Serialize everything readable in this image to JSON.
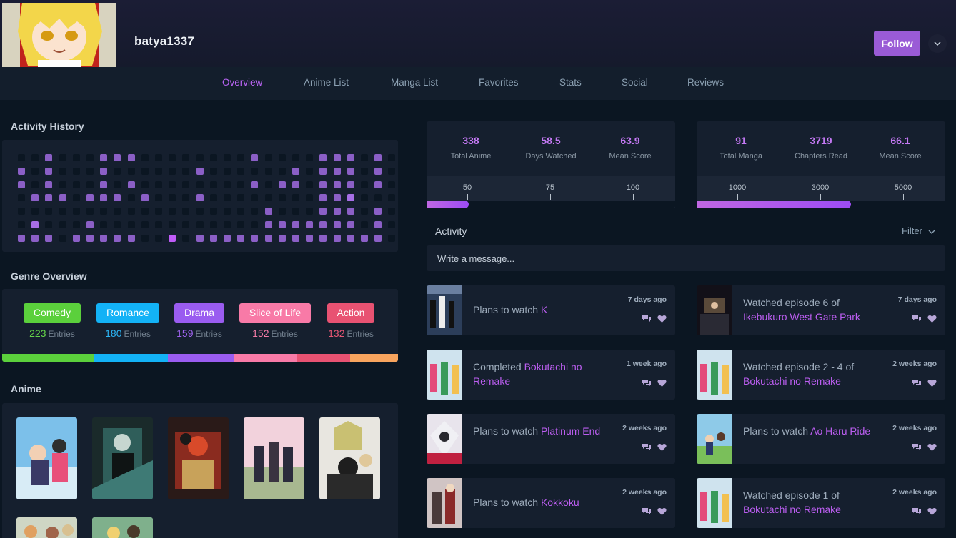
{
  "profile": {
    "username": "batya1337",
    "follow_label": "Follow"
  },
  "icons": {
    "dropdown": "chevron-down-icon",
    "filter": "chevron-down-icon",
    "reply": "comments-icon",
    "like": "heart-icon"
  },
  "nav": [
    "Overview",
    "Anime List",
    "Manga List",
    "Favorites",
    "Stats",
    "Social",
    "Reviews"
  ],
  "nav_active": "Overview",
  "sections": {
    "activity_history": "Activity History",
    "genre_overview": "Genre Overview",
    "anime": "Anime",
    "activity": "Activity"
  },
  "activity_grid": {
    "rows": [
      [
        0,
        0,
        1,
        0,
        0,
        0,
        1,
        1,
        1,
        0,
        0,
        0,
        0,
        0,
        0,
        0,
        0,
        1,
        0,
        0,
        0,
        0,
        1,
        1,
        1,
        0,
        1,
        0
      ],
      [
        1,
        0,
        1,
        0,
        0,
        0,
        1,
        0,
        0,
        0,
        0,
        0,
        0,
        1,
        0,
        0,
        0,
        0,
        0,
        0,
        1,
        0,
        1,
        1,
        1,
        0,
        1,
        0
      ],
      [
        1,
        0,
        1,
        0,
        0,
        0,
        1,
        0,
        1,
        0,
        0,
        0,
        0,
        0,
        0,
        0,
        0,
        1,
        0,
        1,
        1,
        0,
        1,
        1,
        1,
        0,
        1,
        0
      ],
      [
        0,
        1,
        1,
        1,
        0,
        1,
        1,
        1,
        0,
        1,
        0,
        0,
        0,
        1,
        0,
        0,
        0,
        0,
        0,
        0,
        0,
        0,
        1,
        1,
        2,
        0,
        0,
        0
      ],
      [
        0,
        0,
        0,
        0,
        0,
        0,
        0,
        0,
        0,
        0,
        0,
        0,
        0,
        0,
        0,
        0,
        0,
        0,
        1,
        0,
        0,
        0,
        1,
        1,
        1,
        0,
        1,
        0
      ],
      [
        0,
        2,
        0,
        0,
        0,
        1,
        0,
        0,
        0,
        0,
        0,
        0,
        0,
        0,
        0,
        0,
        0,
        0,
        1,
        1,
        1,
        1,
        1,
        1,
        1,
        0,
        1,
        0
      ],
      [
        1,
        1,
        1,
        0,
        1,
        1,
        1,
        1,
        1,
        0,
        0,
        3,
        0,
        1,
        1,
        1,
        1,
        1,
        1,
        1,
        1,
        1,
        1,
        1,
        1,
        1,
        1,
        0
      ]
    ]
  },
  "genres": [
    {
      "name": "Comedy",
      "count": "223",
      "entries_label": "Entries",
      "color": "#5bd03c",
      "count_color": "#65d44a"
    },
    {
      "name": "Romance",
      "count": "180",
      "entries_label": "Entries",
      "color": "#13b2f6",
      "count_color": "#2cb4f4"
    },
    {
      "name": "Drama",
      "count": "159",
      "entries_label": "Entries",
      "color": "#9a5cf0",
      "count_color": "#9f63ef"
    },
    {
      "name": "Slice of Life",
      "count": "152",
      "entries_label": "Entries",
      "color": "#f87aa7",
      "count_color": "#f27aa5"
    },
    {
      "name": "Action",
      "count": "132",
      "entries_label": "Entries",
      "color": "#e85272",
      "count_color": "#e55774"
    }
  ],
  "genre_bar_colors": [
    "#5bd03c",
    "#13b2f6",
    "#9a5cf0",
    "#f87aa7",
    "#e85272",
    "#f8a45e"
  ],
  "anime_stats": {
    "items": [
      {
        "value": "338",
        "label": "Total Anime"
      },
      {
        "value": "58.5",
        "label": "Days Watched"
      },
      {
        "value": "63.9",
        "label": "Mean Score"
      }
    ],
    "scale": [
      "50",
      "75",
      "100"
    ],
    "progress_fraction": 0.17
  },
  "manga_stats": {
    "items": [
      {
        "value": "91",
        "label": "Total Manga"
      },
      {
        "value": "3719",
        "label": "Chapters Read"
      },
      {
        "value": "66.1",
        "label": "Mean Score"
      }
    ],
    "scale": [
      "1000",
      "3000",
      "5000"
    ],
    "progress_fraction": 0.62
  },
  "activity": {
    "filter_label": "Filter",
    "message_placeholder": "Write a message...",
    "items": [
      {
        "prefix": "Plans to watch ",
        "title": "K",
        "time": "7 days ago"
      },
      {
        "prefix": "Watched episode 6 of ",
        "title": "Ikebukuro West Gate Park",
        "time": "7 days ago"
      },
      {
        "prefix": "Completed ",
        "title": "Bokutachi no Remake",
        "time": "1 week ago"
      },
      {
        "prefix": "Watched episode 2 - 4 of ",
        "title": "Bokutachi no Remake",
        "time": "2 weeks ago"
      },
      {
        "prefix": "Plans to watch ",
        "title": "Platinum End",
        "time": "2 weeks ago"
      },
      {
        "prefix": "Plans to watch ",
        "title": "Ao Haru Ride",
        "time": "2 weeks ago"
      },
      {
        "prefix": "Plans to watch ",
        "title": "Kokkoku",
        "time": "2 weeks ago"
      },
      {
        "prefix": "Watched episode 1 of ",
        "title": "Bokutachi no Remake",
        "time": "2 weeks ago"
      }
    ]
  }
}
